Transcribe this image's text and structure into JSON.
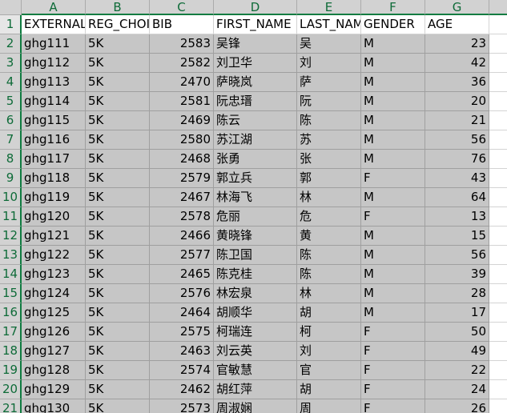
{
  "columns": [
    "A",
    "B",
    "C",
    "D",
    "E",
    "F",
    "G"
  ],
  "header": [
    "EXTERNAL_ID",
    "REG_CHOICE",
    "BIB",
    "FIRST_NAME",
    "LAST_NAME",
    "GENDER",
    "AGE"
  ],
  "rows": [
    [
      "ghg111",
      "5K",
      "2583",
      "吴锋",
      "吴",
      "M",
      "23"
    ],
    [
      "ghg112",
      "5K",
      "2582",
      "刘卫华",
      "刘",
      "M",
      "42"
    ],
    [
      "ghg113",
      "5K",
      "2470",
      "萨晓岚",
      "萨",
      "M",
      "36"
    ],
    [
      "ghg114",
      "5K",
      "2581",
      "阮忠瑨",
      "阮",
      "M",
      "20"
    ],
    [
      "ghg115",
      "5K",
      "2469",
      "陈云",
      "陈",
      "M",
      "21"
    ],
    [
      "ghg116",
      "5K",
      "2580",
      "苏江湖",
      "苏",
      "M",
      "56"
    ],
    [
      "ghg117",
      "5K",
      "2468",
      "张勇",
      "张",
      "M",
      "76"
    ],
    [
      "ghg118",
      "5K",
      "2579",
      "郭立兵",
      "郭",
      "F",
      "43"
    ],
    [
      "ghg119",
      "5K",
      "2467",
      "林海飞",
      "林",
      "M",
      "64"
    ],
    [
      "ghg120",
      "5K",
      "2578",
      "危丽",
      "危",
      "F",
      "13"
    ],
    [
      "ghg121",
      "5K",
      "2466",
      "黄晓锋",
      "黄",
      "M",
      "15"
    ],
    [
      "ghg122",
      "5K",
      "2577",
      "陈卫国",
      "陈",
      "M",
      "56"
    ],
    [
      "ghg123",
      "5K",
      "2465",
      "陈克桂",
      "陈",
      "M",
      "39"
    ],
    [
      "ghg124",
      "5K",
      "2576",
      "林宏泉",
      "林",
      "M",
      "28"
    ],
    [
      "ghg125",
      "5K",
      "2464",
      "胡顺华",
      "胡",
      "M",
      "17"
    ],
    [
      "ghg126",
      "5K",
      "2575",
      "柯瑞连",
      "柯",
      "F",
      "50"
    ],
    [
      "ghg127",
      "5K",
      "2463",
      "刘云英",
      "刘",
      "F",
      "49"
    ],
    [
      "ghg128",
      "5K",
      "2574",
      "官敏慧",
      "官",
      "F",
      "22"
    ],
    [
      "ghg129",
      "5K",
      "2462",
      "胡红萍",
      "胡",
      "F",
      "24"
    ],
    [
      "ghg130",
      "5K",
      "2573",
      "周淑娴",
      "周",
      "F",
      "26"
    ]
  ]
}
